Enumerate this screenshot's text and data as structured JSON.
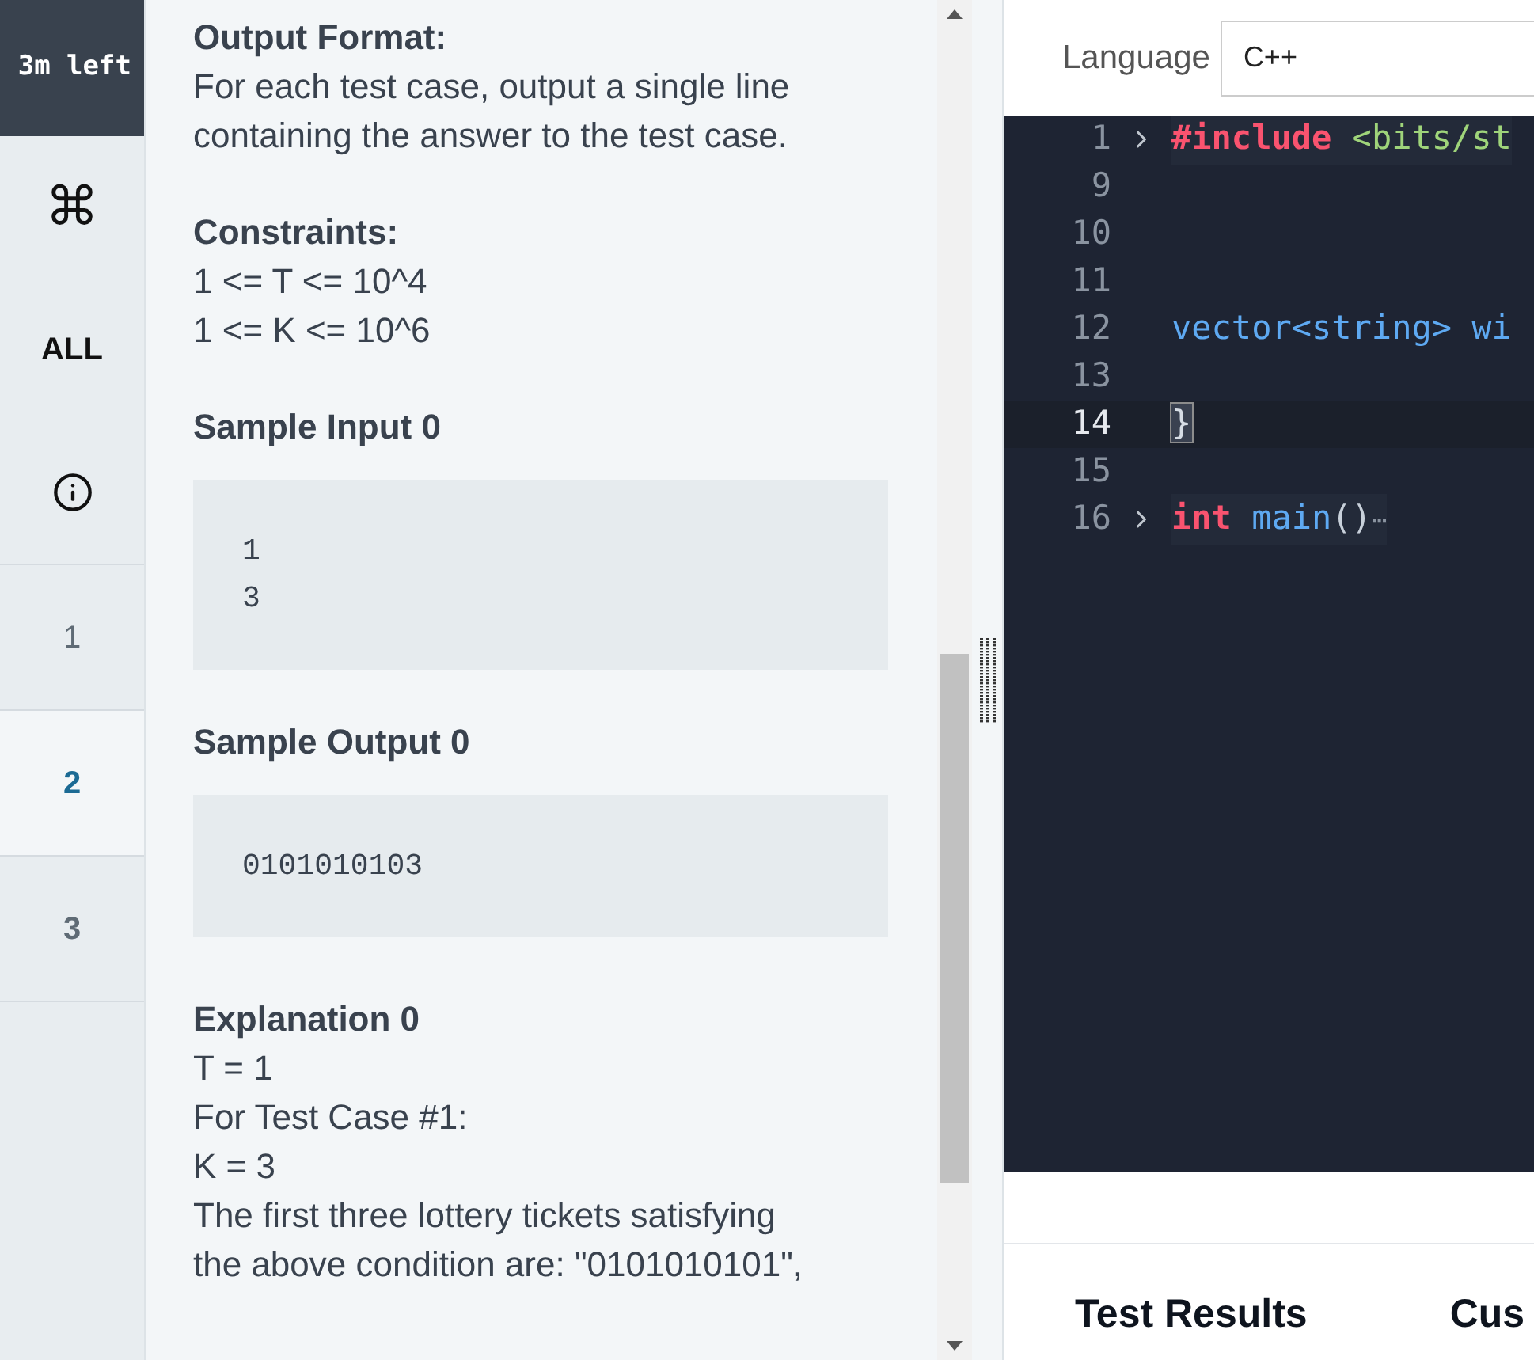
{
  "sidebar": {
    "timer": "3m left",
    "tools": [
      {
        "kind": "glyph",
        "text": "⌘"
      },
      {
        "kind": "text",
        "text": "ALL"
      },
      {
        "kind": "info"
      }
    ],
    "questions": [
      {
        "label": "1",
        "selected": false
      },
      {
        "label": "2",
        "selected": true
      },
      {
        "label": "3",
        "selected": false
      }
    ]
  },
  "problem": {
    "sections": [
      {
        "kind": "text",
        "heading": "Output Format:",
        "lines": [
          "For each test case, output a single line",
          "containing the answer to the test case."
        ]
      },
      {
        "kind": "text",
        "heading": "Constraints:",
        "lines": [
          "1 <= T <= 10^4",
          "1 <= K <= 10^6"
        ]
      },
      {
        "kind": "code",
        "heading": "Sample Input 0",
        "lines": [
          "1",
          "3"
        ]
      },
      {
        "kind": "code",
        "heading": "Sample Output 0",
        "lines": [
          "0101010103"
        ]
      },
      {
        "kind": "text",
        "heading": "Explanation 0",
        "lines": [
          "T = 1",
          "For Test Case #1:",
          "K = 3",
          "The first three lottery tickets satisfying",
          "the above condition are: \"0101010101\","
        ]
      }
    ]
  },
  "editor": {
    "language_label": "Language",
    "language": "C++",
    "lines": [
      {
        "num": "1",
        "fold": true,
        "current": false,
        "tokens": [
          {
            "kind": "keyword",
            "text": "#include"
          },
          {
            "kind": "string",
            "text": " <bits/st"
          }
        ]
      },
      {
        "num": "9",
        "fold": false,
        "current": false
      },
      {
        "num": "10",
        "fold": false,
        "current": false
      },
      {
        "num": "11",
        "fold": false,
        "current": false
      },
      {
        "num": "12",
        "fold": false,
        "current": false,
        "tokens": [
          {
            "kind": "type",
            "text": "vector<string> wi"
          }
        ]
      },
      {
        "num": "13",
        "fold": false,
        "current": false
      },
      {
        "num": "14",
        "fold": false,
        "current": true,
        "tokens": [
          {
            "kind": "brace",
            "text": "}"
          }
        ]
      },
      {
        "num": "15",
        "fold": false,
        "current": false
      },
      {
        "num": "16",
        "fold": true,
        "current": false,
        "tokens": [
          {
            "kind": "keyword",
            "text": "int"
          },
          {
            "kind": "type",
            "text": " main"
          },
          {
            "kind": "punct",
            "text": "()"
          },
          {
            "kind": "ellipsis",
            "text": "⋯"
          }
        ]
      }
    ]
  },
  "results": {
    "tabs": [
      {
        "label": "Test Results"
      },
      {
        "label": "Cus"
      }
    ]
  }
}
